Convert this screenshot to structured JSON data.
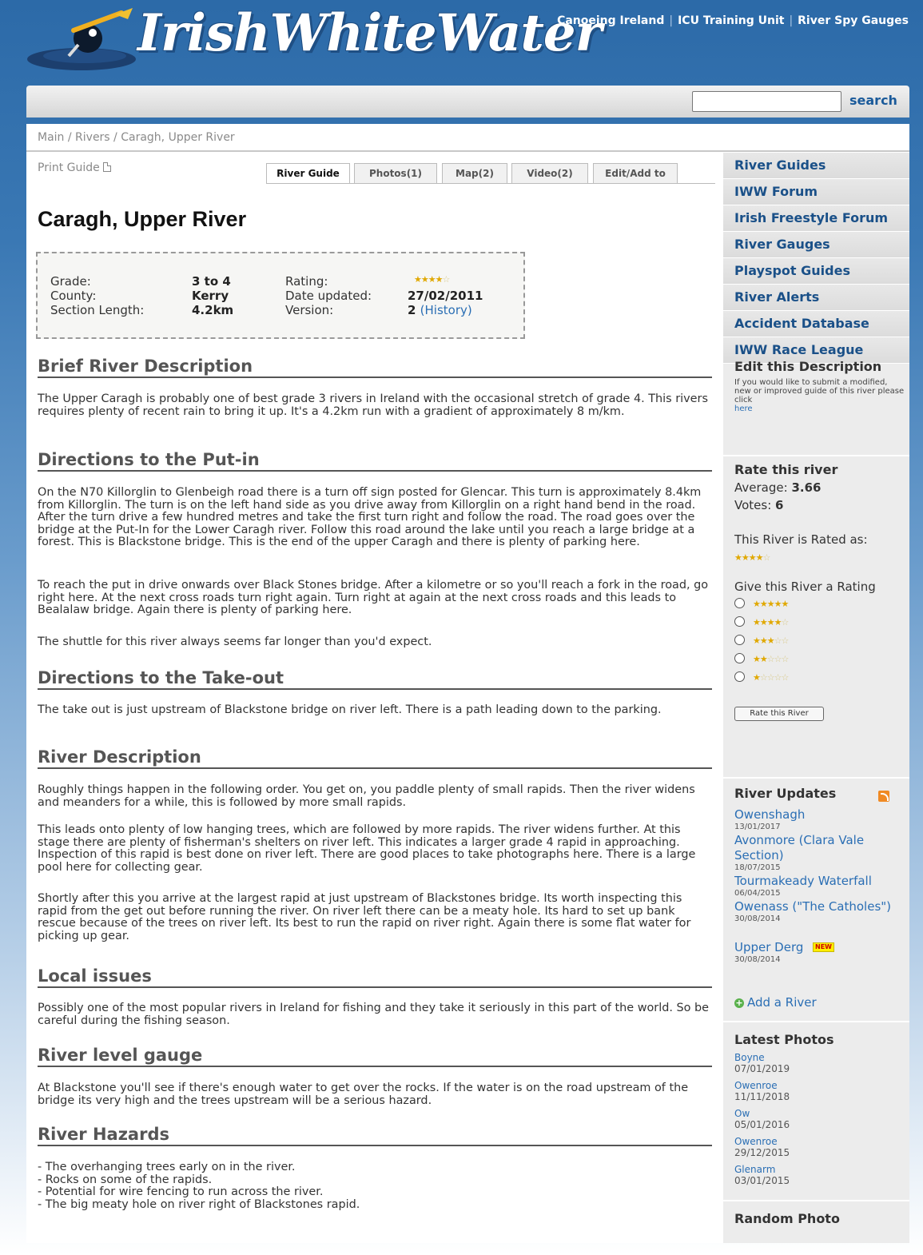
{
  "header": {
    "logo_text": "IrishWhiteWater",
    "links": [
      "Canoeing Ireland",
      "ICU Training Unit",
      "River Spy Gauges"
    ],
    "link_separator": "|"
  },
  "search": {
    "value": "",
    "button_label": "search"
  },
  "breadcrumb": "Main / Rivers / Caragh, Upper River",
  "print_guide": "Print Guide",
  "tabs": [
    "River Guide",
    "Photos(1)",
    "Map(2)",
    "Video(2)",
    "Edit/Add to"
  ],
  "active_tab": "River Guide",
  "title": "Caragh, Upper River",
  "info": {
    "grade_label": "Grade:",
    "grade": "3 to 4",
    "county_label": "County:",
    "county": "Kerry",
    "length_label": "Section Length:",
    "length": "4.2km",
    "rating_label": "Rating:",
    "rating_stars": 4,
    "date_label": "Date updated:",
    "date": "27/02/2011",
    "version_label": "Version:",
    "version": "2",
    "history_link": "(History)"
  },
  "sections": {
    "brief_h": "Brief River Description",
    "brief_p": "The Upper Caragh is probably one of best grade 3 rivers in Ireland with the occasional stretch of grade 4. This rivers requires plenty of recent rain to bring it up. It's a 4.2km run with a gradient of approximately 8 m/km.",
    "putin_h": "Directions to the Put-in",
    "putin_p1": "On the N70 Killorglin to Glenbeigh road there is a turn off sign posted for Glencar. This turn is approximately 8.4km from Killorglin. The turn is on the left hand side as you drive away from Killorglin on a right hand bend in the road. After the turn drive a few hundred metres and take the first turn right and follow the road. The road goes over the bridge at the Put-In for the Lower Caragh river. Follow this road around the lake until you reach a large bridge at a forest. This is Blackstone bridge. This is the end of the upper Caragh and there is plenty of parking here.",
    "putin_p2": "To reach the put in drive onwards over Black Stones bridge. After a kilometre or so you'll reach a fork in the road, go right here. At the next cross roads turn right again. Turn right at again at the next cross roads and this leads to Bealalaw bridge. Again there is plenty of parking here.",
    "putin_p3": "The shuttle for this river always seems far longer than you'd expect.",
    "takeout_h": "Directions to the Take-out",
    "takeout_p": "The take out is just upstream of Blackstone bridge on river left. There is a path leading down to the parking.",
    "desc_h": "River Description",
    "desc_p1": "Roughly things happen in the following order. You get on, you paddle plenty of small rapids. Then the river widens and meanders for a while, this is followed by more small rapids.",
    "desc_p2": "This leads onto plenty of low hanging trees, which are followed by more rapids. The river widens further. At this stage there are plenty of fisherman's shelters on river left. This indicates a larger grade 4 rapid in approaching. Inspection of this rapid is best done on river left. There are good places to take photographs here. There is a large pool here for collecting gear.",
    "desc_p3": "Shortly after this you arrive at the largest rapid at just upstream of Blackstones bridge. Its worth inspecting this rapid from the get out before running the river. On river left there can be a meaty hole. Its hard to set up bank rescue because of the trees on river left. Its best to run the rapid on river right. Again there is some flat water for picking up gear.",
    "local_h": "Local issues",
    "local_p": "Possibly one of the most popular rivers in Ireland for fishing and they take it seriously in this part of the world. So be careful during the fishing season.",
    "gauge_h": "River level gauge",
    "gauge_p": "At Blackstone you'll see if there's enough water to get over the rocks. If the water is on the road upstream of the bridge its very high and the trees upstream will be a serious hazard.",
    "hazards_h": "River Hazards",
    "hazards": [
      "- The overhanging trees early on in the river.",
      "- Rocks on some of the rapids.",
      "- Potential for wire fencing to run across the river.",
      "- The big meaty hole on river right of Blackstones rapid."
    ]
  },
  "sidebar": {
    "nav": [
      "River Guides",
      "IWW Forum",
      "Irish Freestyle Forum",
      "River Gauges",
      "Playspot Guides",
      "River Alerts",
      "Accident Database",
      "IWW Race League"
    ],
    "edit_h": "Edit this Description",
    "edit_text": "If you would like to submit a modified, new or improved guide of this river please click",
    "edit_link": "here",
    "rate_h": "Rate this river",
    "average_label": "Average:",
    "average": "3.66",
    "votes_label": "Votes:",
    "votes": "6",
    "rated_as": "This River is Rated as:",
    "rated_stars": 4,
    "give_rating": "Give this River a Rating",
    "rating_options": [
      5,
      4,
      3,
      2,
      1
    ],
    "rate_button": "Rate this River",
    "updates_h": "River Updates",
    "updates": [
      {
        "name": "Owenshagh",
        "date": "13/01/2017"
      },
      {
        "name": "Avonmore (Clara Vale Section)",
        "date": "18/07/2015"
      },
      {
        "name": "Tourmakeady Waterfall",
        "date": "06/04/2015"
      },
      {
        "name": "Owenass (\"The Catholes\")",
        "date": "30/08/2014"
      },
      {
        "name": "Upper Derg",
        "date": "30/08/2014"
      }
    ],
    "new_badge": "NEW",
    "add_river": "Add a River",
    "photos_h": "Latest Photos",
    "photos": [
      {
        "name": "Boyne",
        "date": "07/01/2019"
      },
      {
        "name": "Owenroe",
        "date": "11/11/2018"
      },
      {
        "name": "Ow",
        "date": "05/01/2016"
      },
      {
        "name": "Owenroe",
        "date": "29/12/2015"
      },
      {
        "name": "Glenarm",
        "date": "03/01/2015"
      }
    ],
    "random_h": "Random Photo"
  },
  "colors": {
    "link": "#2a6eb4",
    "nav_text": "#1a5088",
    "star": "#e0a800",
    "header_blue": "#2c6aa8"
  }
}
